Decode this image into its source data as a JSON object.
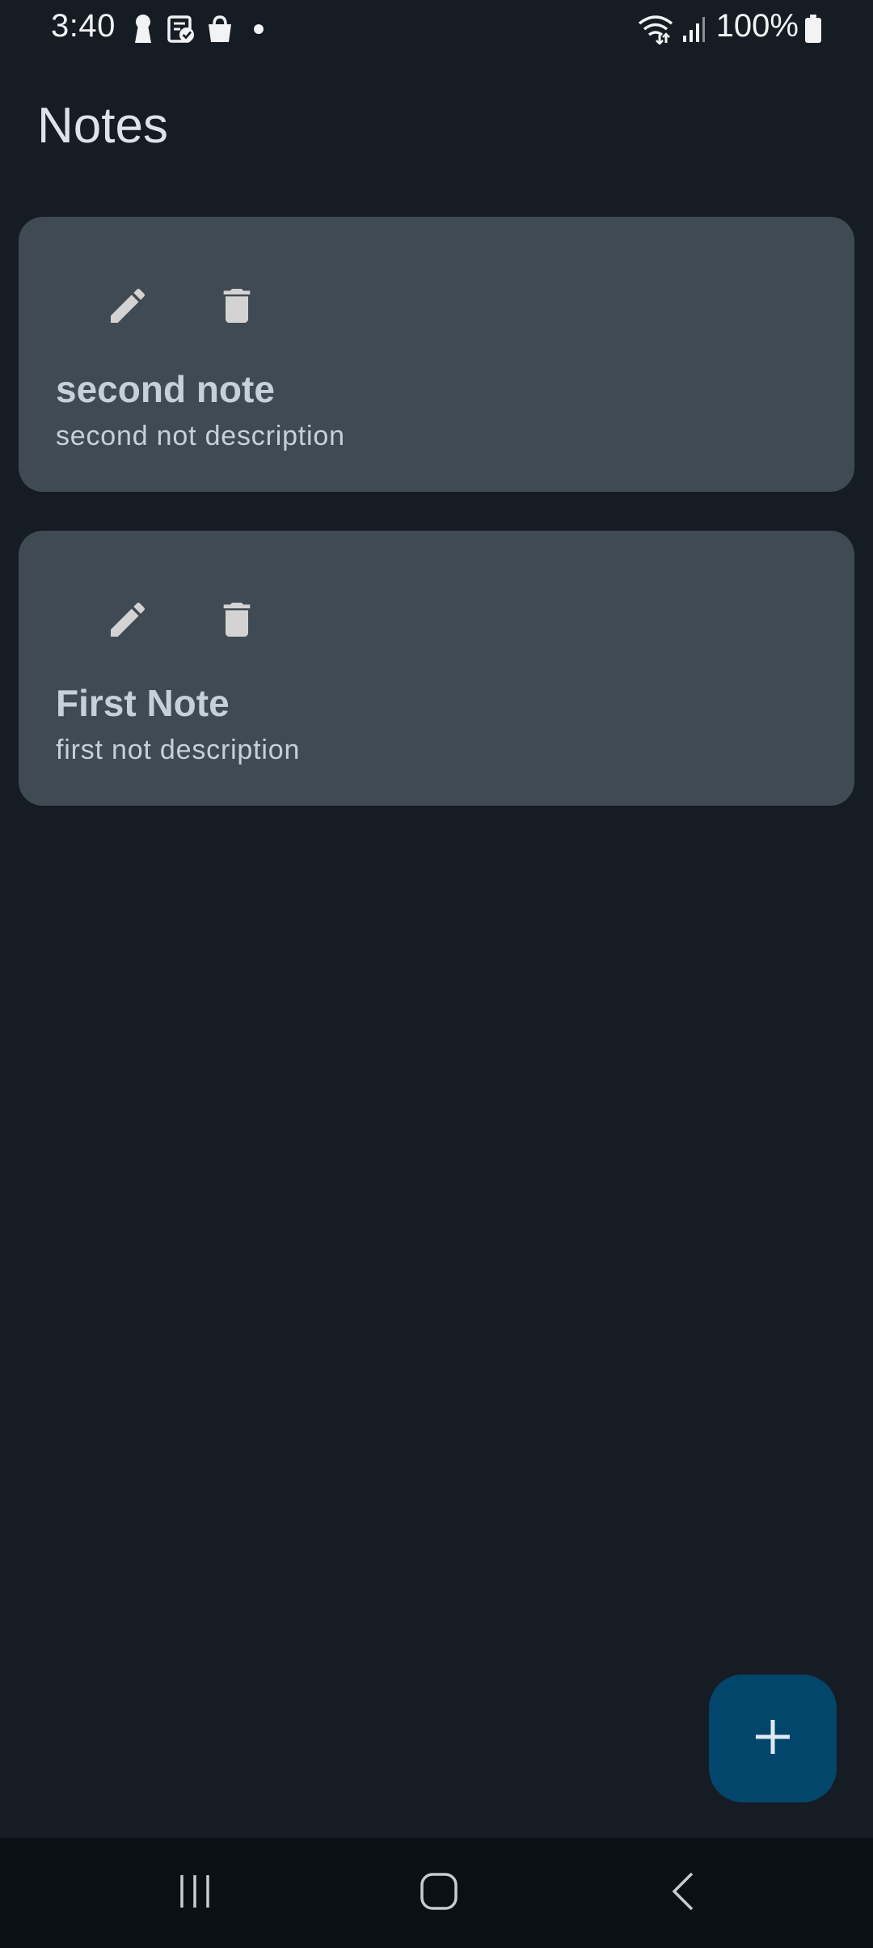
{
  "status_bar": {
    "time": "3:40",
    "battery": "100%",
    "icons": [
      "keyhole-icon",
      "clipboard-check-icon",
      "shopping-bag-icon",
      "dot-icon",
      "wifi-icon",
      "signal-icon",
      "battery-icon"
    ]
  },
  "header": {
    "title": "Notes"
  },
  "notes": [
    {
      "title": "second note",
      "description": "second not description"
    },
    {
      "title": "First Note",
      "description": "first not description"
    }
  ],
  "fab": {
    "icon": "plus-icon"
  },
  "nav_bar": {
    "icons": [
      "recent-apps-icon",
      "home-icon",
      "back-icon"
    ]
  },
  "colors": {
    "background": "#161c24",
    "card": "#404a53",
    "fab": "#03466c",
    "nav_bar": "#0b1015",
    "text": "#c6d0d8"
  }
}
